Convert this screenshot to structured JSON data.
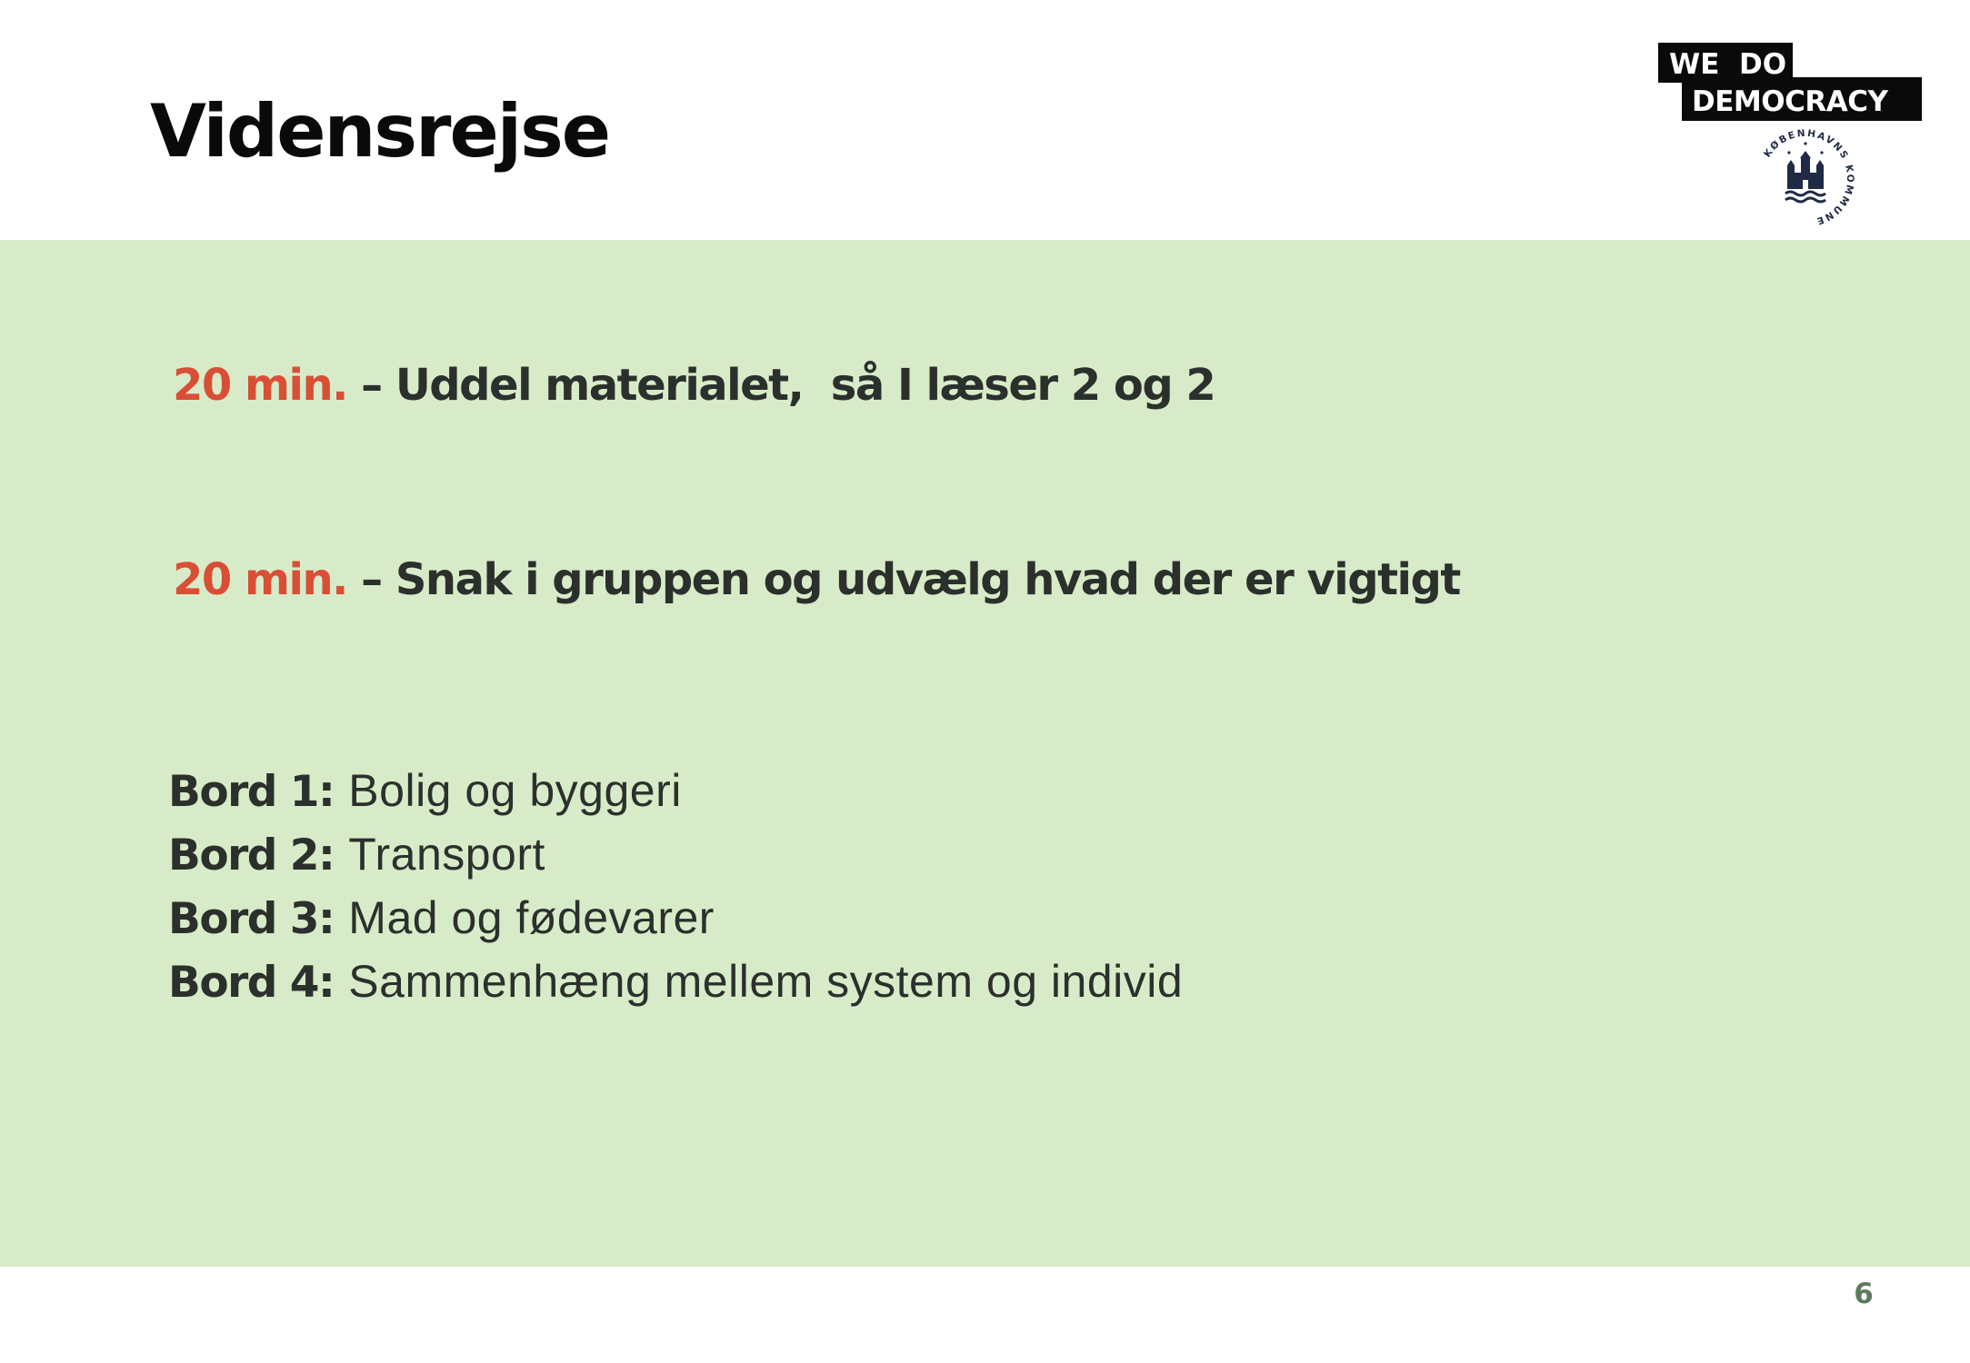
{
  "slide": {
    "title": "Vidensrejse",
    "page_number": "6"
  },
  "logos": {
    "we_do_democracy": {
      "line1": "WE  DO",
      "line2": "DEMOCRACY"
    },
    "seal": {
      "text": "KØBENHAVNS KOMMUNE",
      "color": "#1f2a44"
    }
  },
  "steps": [
    {
      "time": "20 min.",
      "separator": "–",
      "text": "Uddel materialet,  så I læser 2 og 2"
    },
    {
      "time": "20 min.",
      "separator": "–",
      "text": "Snak i gruppen og udvælg hvad der er vigtigt"
    }
  ],
  "tables": [
    {
      "label": "Bord 1:",
      "topic": "Bolig og byggeri"
    },
    {
      "label": "Bord 2:",
      "topic": "Transport"
    },
    {
      "label": "Bord 3:",
      "topic": "Mad og fødevarer"
    },
    {
      "label": "Bord 4:",
      "topic": "Sammenhæng mellem system og individ"
    }
  ],
  "colors": {
    "panel_background": "#d8ebc8",
    "accent_time": "#d94f36",
    "body_text": "#2b302d",
    "page_number": "#5e7a5e"
  }
}
